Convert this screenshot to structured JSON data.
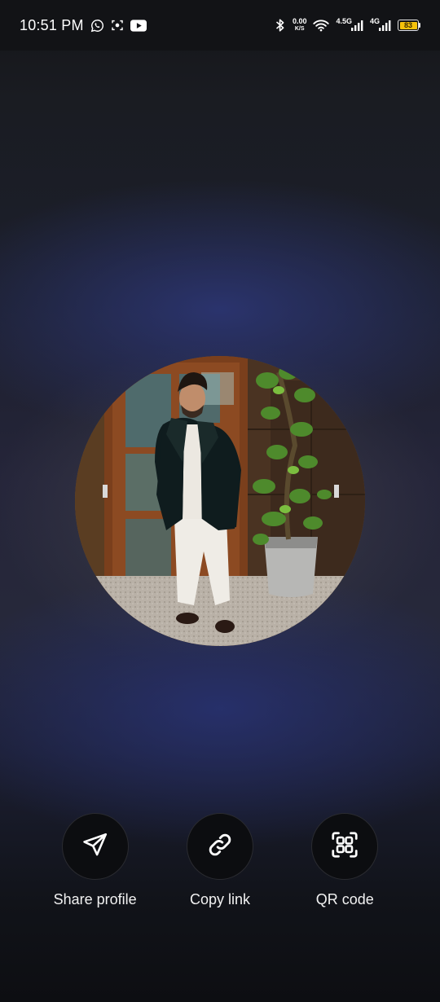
{
  "status_bar": {
    "time": "10:51 PM",
    "net_speed_value": "0.00",
    "net_speed_unit": "K/S",
    "network_1": "4.5G",
    "network_2": "4G",
    "battery_level": "83",
    "icons": [
      "whatsapp-icon",
      "screen-record-icon",
      "youtube-icon",
      "bluetooth-icon",
      "wifi-icon",
      "signal-icon",
      "battery-icon"
    ]
  },
  "actions": [
    {
      "label": "Share profile",
      "icon": "send-icon"
    },
    {
      "label": "Copy link",
      "icon": "link-icon"
    },
    {
      "label": "QR code",
      "icon": "qr-code-icon"
    }
  ],
  "colors": {
    "battery": "#f5c20a",
    "button_bg": "#0c0d10"
  }
}
